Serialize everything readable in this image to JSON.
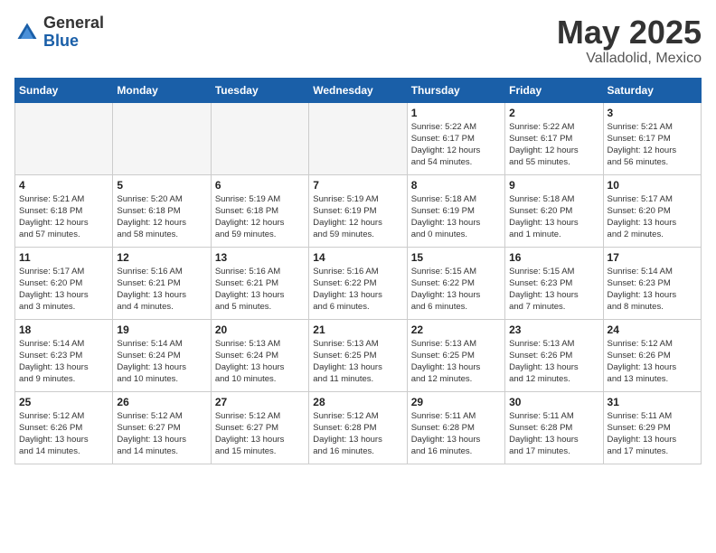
{
  "header": {
    "logo_general": "General",
    "logo_blue": "Blue",
    "title": "May 2025",
    "subtitle": "Valladolid, Mexico"
  },
  "days_of_week": [
    "Sunday",
    "Monday",
    "Tuesday",
    "Wednesday",
    "Thursday",
    "Friday",
    "Saturday"
  ],
  "weeks": [
    [
      {
        "day": "",
        "info": ""
      },
      {
        "day": "",
        "info": ""
      },
      {
        "day": "",
        "info": ""
      },
      {
        "day": "",
        "info": ""
      },
      {
        "day": "1",
        "info": "Sunrise: 5:22 AM\nSunset: 6:17 PM\nDaylight: 12 hours\nand 54 minutes."
      },
      {
        "day": "2",
        "info": "Sunrise: 5:22 AM\nSunset: 6:17 PM\nDaylight: 12 hours\nand 55 minutes."
      },
      {
        "day": "3",
        "info": "Sunrise: 5:21 AM\nSunset: 6:17 PM\nDaylight: 12 hours\nand 56 minutes."
      }
    ],
    [
      {
        "day": "4",
        "info": "Sunrise: 5:21 AM\nSunset: 6:18 PM\nDaylight: 12 hours\nand 57 minutes."
      },
      {
        "day": "5",
        "info": "Sunrise: 5:20 AM\nSunset: 6:18 PM\nDaylight: 12 hours\nand 58 minutes."
      },
      {
        "day": "6",
        "info": "Sunrise: 5:19 AM\nSunset: 6:18 PM\nDaylight: 12 hours\nand 59 minutes."
      },
      {
        "day": "7",
        "info": "Sunrise: 5:19 AM\nSunset: 6:19 PM\nDaylight: 12 hours\nand 59 minutes."
      },
      {
        "day": "8",
        "info": "Sunrise: 5:18 AM\nSunset: 6:19 PM\nDaylight: 13 hours\nand 0 minutes."
      },
      {
        "day": "9",
        "info": "Sunrise: 5:18 AM\nSunset: 6:20 PM\nDaylight: 13 hours\nand 1 minute."
      },
      {
        "day": "10",
        "info": "Sunrise: 5:17 AM\nSunset: 6:20 PM\nDaylight: 13 hours\nand 2 minutes."
      }
    ],
    [
      {
        "day": "11",
        "info": "Sunrise: 5:17 AM\nSunset: 6:20 PM\nDaylight: 13 hours\nand 3 minutes."
      },
      {
        "day": "12",
        "info": "Sunrise: 5:16 AM\nSunset: 6:21 PM\nDaylight: 13 hours\nand 4 minutes."
      },
      {
        "day": "13",
        "info": "Sunrise: 5:16 AM\nSunset: 6:21 PM\nDaylight: 13 hours\nand 5 minutes."
      },
      {
        "day": "14",
        "info": "Sunrise: 5:16 AM\nSunset: 6:22 PM\nDaylight: 13 hours\nand 6 minutes."
      },
      {
        "day": "15",
        "info": "Sunrise: 5:15 AM\nSunset: 6:22 PM\nDaylight: 13 hours\nand 6 minutes."
      },
      {
        "day": "16",
        "info": "Sunrise: 5:15 AM\nSunset: 6:23 PM\nDaylight: 13 hours\nand 7 minutes."
      },
      {
        "day": "17",
        "info": "Sunrise: 5:14 AM\nSunset: 6:23 PM\nDaylight: 13 hours\nand 8 minutes."
      }
    ],
    [
      {
        "day": "18",
        "info": "Sunrise: 5:14 AM\nSunset: 6:23 PM\nDaylight: 13 hours\nand 9 minutes."
      },
      {
        "day": "19",
        "info": "Sunrise: 5:14 AM\nSunset: 6:24 PM\nDaylight: 13 hours\nand 10 minutes."
      },
      {
        "day": "20",
        "info": "Sunrise: 5:13 AM\nSunset: 6:24 PM\nDaylight: 13 hours\nand 10 minutes."
      },
      {
        "day": "21",
        "info": "Sunrise: 5:13 AM\nSunset: 6:25 PM\nDaylight: 13 hours\nand 11 minutes."
      },
      {
        "day": "22",
        "info": "Sunrise: 5:13 AM\nSunset: 6:25 PM\nDaylight: 13 hours\nand 12 minutes."
      },
      {
        "day": "23",
        "info": "Sunrise: 5:13 AM\nSunset: 6:26 PM\nDaylight: 13 hours\nand 12 minutes."
      },
      {
        "day": "24",
        "info": "Sunrise: 5:12 AM\nSunset: 6:26 PM\nDaylight: 13 hours\nand 13 minutes."
      }
    ],
    [
      {
        "day": "25",
        "info": "Sunrise: 5:12 AM\nSunset: 6:26 PM\nDaylight: 13 hours\nand 14 minutes."
      },
      {
        "day": "26",
        "info": "Sunrise: 5:12 AM\nSunset: 6:27 PM\nDaylight: 13 hours\nand 14 minutes."
      },
      {
        "day": "27",
        "info": "Sunrise: 5:12 AM\nSunset: 6:27 PM\nDaylight: 13 hours\nand 15 minutes."
      },
      {
        "day": "28",
        "info": "Sunrise: 5:12 AM\nSunset: 6:28 PM\nDaylight: 13 hours\nand 16 minutes."
      },
      {
        "day": "29",
        "info": "Sunrise: 5:11 AM\nSunset: 6:28 PM\nDaylight: 13 hours\nand 16 minutes."
      },
      {
        "day": "30",
        "info": "Sunrise: 5:11 AM\nSunset: 6:28 PM\nDaylight: 13 hours\nand 17 minutes."
      },
      {
        "day": "31",
        "info": "Sunrise: 5:11 AM\nSunset: 6:29 PM\nDaylight: 13 hours\nand 17 minutes."
      }
    ]
  ]
}
